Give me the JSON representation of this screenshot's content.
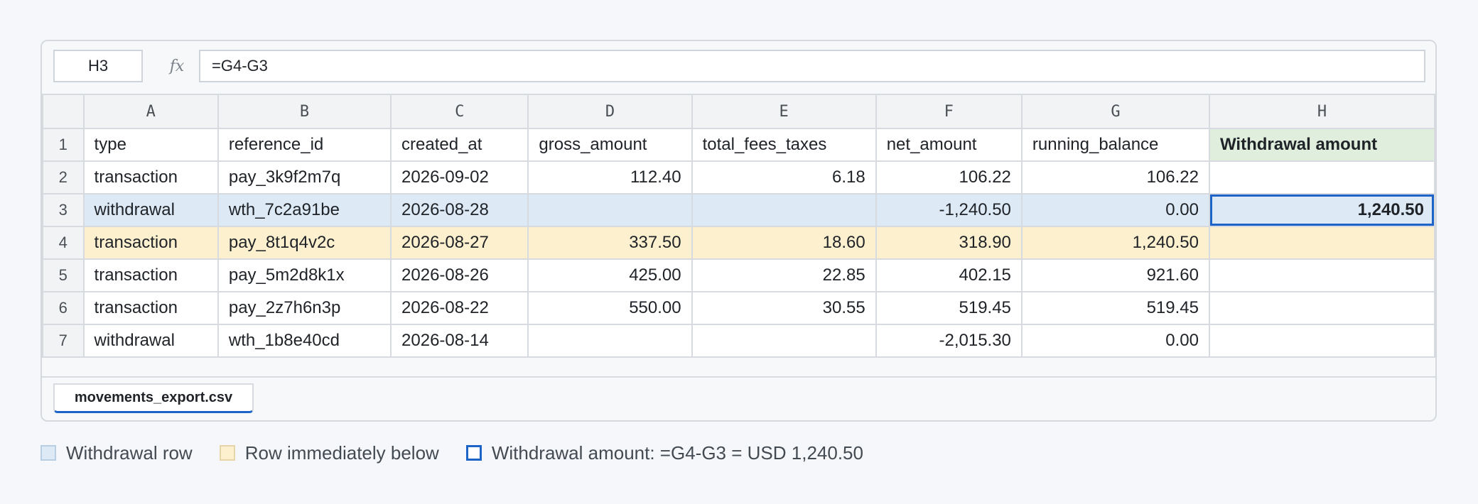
{
  "formula_bar": {
    "cell_ref": "H3",
    "fx_label": "fx",
    "formula": "=G4-G3"
  },
  "columns": [
    "A",
    "B",
    "C",
    "D",
    "E",
    "F",
    "G",
    "H"
  ],
  "rows": [
    {
      "num": "1",
      "cells": [
        "type",
        "reference_id",
        "created_at",
        "gross_amount",
        "total_fees_taxes",
        "net_amount",
        "running_balance",
        "Withdrawal amount"
      ]
    },
    {
      "num": "2",
      "cells": [
        "transaction",
        "pay_3k9f2m7q",
        "2026-09-02",
        "112.40",
        "6.18",
        "106.22",
        "106.22",
        ""
      ]
    },
    {
      "num": "3",
      "cells": [
        "withdrawal",
        "wth_7c2a91be",
        "2026-08-28",
        "",
        "",
        "-1,240.50",
        "0.00",
        "1,240.50"
      ]
    },
    {
      "num": "4",
      "cells": [
        "transaction",
        "pay_8t1q4v2c",
        "2026-08-27",
        "337.50",
        "18.60",
        "318.90",
        "1,240.50",
        ""
      ]
    },
    {
      "num": "5",
      "cells": [
        "transaction",
        "pay_5m2d8k1x",
        "2026-08-26",
        "425.00",
        "22.85",
        "402.15",
        "921.60",
        ""
      ]
    },
    {
      "num": "6",
      "cells": [
        "transaction",
        "pay_2z7h6n3p",
        "2026-08-22",
        "550.00",
        "30.55",
        "519.45",
        "519.45",
        ""
      ]
    },
    {
      "num": "7",
      "cells": [
        "withdrawal",
        "wth_1b8e40cd",
        "2026-08-14",
        "",
        "",
        "-2,015.30",
        "0.00",
        ""
      ]
    }
  ],
  "selected_cell": "H3",
  "sheet_tab": "movements_export.csv",
  "legend": {
    "withdrawal_row": "Withdrawal row",
    "row_below": "Row immediately below",
    "withdrawal_amount": "Withdrawal amount: =G4-G3 = USD 1,240.50"
  },
  "colors": {
    "withdrawal_row": "#dde9f5",
    "row_below": "#fdf0cf",
    "selection": "#1d64c8",
    "header_h": "#dfeedd"
  }
}
